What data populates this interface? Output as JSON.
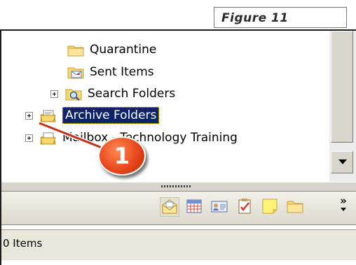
{
  "caption": "Figure 11",
  "tree": {
    "items": [
      {
        "label": "Quarantine"
      },
      {
        "label": "Sent Items"
      },
      {
        "label": "Search Folders"
      },
      {
        "label": "Archive Folders"
      },
      {
        "label": "Mailbox - Technology Training"
      }
    ]
  },
  "navigation": {
    "buttons": [
      "mail-icon",
      "calendar-icon",
      "contacts-icon",
      "tasks-icon",
      "notes-icon",
      "folder-list-icon"
    ],
    "more_label": "»"
  },
  "status": {
    "text": "0 Items"
  },
  "callout": {
    "number": "1",
    "color": "#e8481c"
  },
  "colors": {
    "selection": "#0a246a",
    "toolbar": "#dcd8cc"
  }
}
